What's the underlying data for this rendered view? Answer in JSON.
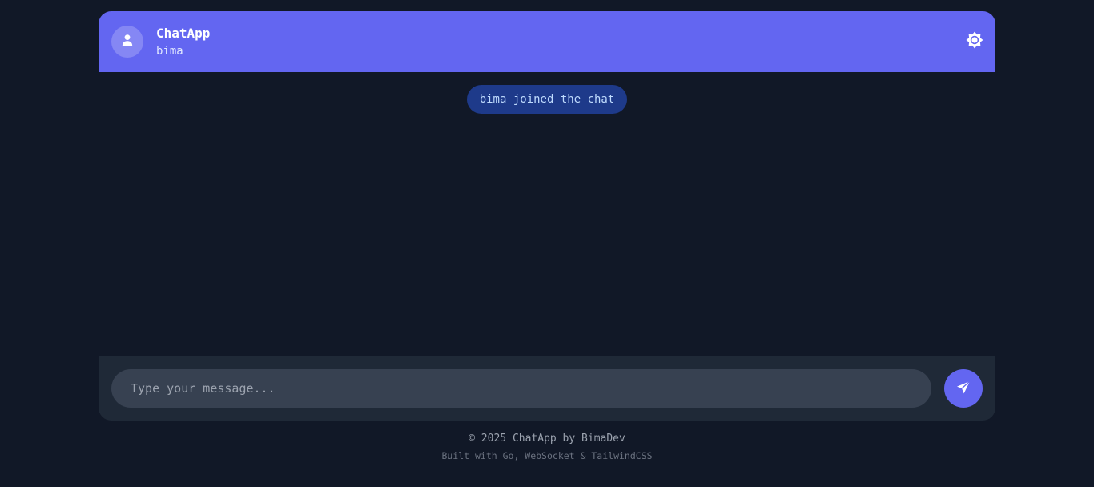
{
  "header": {
    "title": "ChatApp",
    "username": "bima",
    "avatar_icon": "user-icon",
    "theme_toggle_icon": "sun-icon",
    "background_color": "#6366f1"
  },
  "messages": [
    {
      "type": "system",
      "text": "bima joined the chat"
    }
  ],
  "composer": {
    "placeholder": "Type your message...",
    "value": "",
    "send_icon": "paper-plane-icon"
  },
  "footer": {
    "copyright": "© 2025 ChatApp by BimaDev",
    "built_with": "Built with Go, WebSocket & TailwindCSS"
  },
  "colors": {
    "page_background": "#111827",
    "accent": "#6366f1",
    "system_pill_bg": "#1e3a8a",
    "system_pill_text": "#bfdbfe",
    "composer_bg": "#1f2937",
    "input_bg": "#374151"
  }
}
